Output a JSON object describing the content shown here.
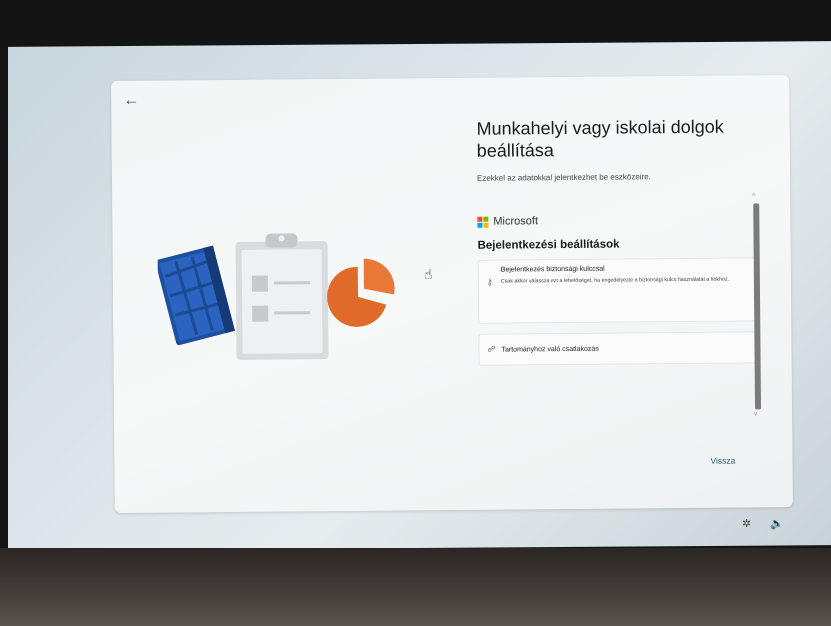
{
  "page": {
    "title": "Munkahelyi vagy iskolai dolgok beállítása",
    "subtitle": "Ezekkel az adatokkal jelentkezhet be eszközeire."
  },
  "brand": {
    "name": "Microsoft"
  },
  "section": {
    "heading": "Bejelentkezési beállítások"
  },
  "options": [
    {
      "title": "Bejelentkezés biztonsági kulccsal",
      "description": "Csak akkor válassza ezt a lehetőséget, ha engedélyezte a biztonsági kulcs használatát a fiókhoz.",
      "icon": "key-icon"
    },
    {
      "title": "Tartományhoz való csatlakozás",
      "icon": "domain-join-icon"
    }
  ],
  "footer": {
    "back_label": "Vissza"
  },
  "icons": {
    "back": "←",
    "scroll_up": "^",
    "scroll_down": "v",
    "accessibility": "accessibility-icon",
    "volume": "volume-icon"
  },
  "colors": {
    "ms_red": "#f25022",
    "ms_green": "#7fba00",
    "ms_blue": "#00a4ef",
    "ms_yellow": "#ffb900",
    "accent_link": "#2c5f78"
  }
}
